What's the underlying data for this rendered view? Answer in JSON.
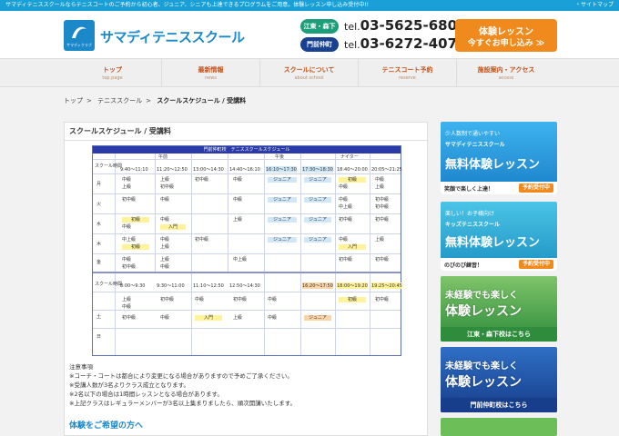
{
  "topbar": {
    "message": "サマディテニススクールならテニスコートのご予約から初心者、ジュニア、シニアも上達できるプログラムをご用意。体験レッスン申し込み受付中!!",
    "sitemap": "・サイトマップ"
  },
  "header": {
    "logo_small": "サマディクラブ",
    "logo_text": "サマディテニススクール",
    "areas": [
      "江東・森下",
      "門前仲町"
    ],
    "tel_prefix": "tel.",
    "tels": [
      "03-5625-6801",
      "03-6272-4077"
    ],
    "cta_line1": "体験レッスン",
    "cta_line2": "今すぐお申し込み ≫"
  },
  "nav": [
    {
      "jp": "トップ",
      "en": "top page"
    },
    {
      "jp": "最新情報",
      "en": "news"
    },
    {
      "jp": "スクールについて",
      "en": "about school"
    },
    {
      "jp": "テニスコート予約",
      "en": "reserve"
    },
    {
      "jp": "施設案内・アクセス",
      "en": "access"
    }
  ],
  "breadcrumb": [
    "トップ",
    "テニススクール",
    "スクールスケジュール / 受講料"
  ],
  "page_title": "スクールスケジュール / 受講料",
  "schedule": {
    "title": "門前仲町校　テニススクールスケジュール",
    "times_top": [
      "9:40〜11:10",
      "11:20〜12:50",
      "13:00〜14:30",
      "14:40〜16:10",
      "16:10〜17:30",
      "17:30〜18:30",
      "18:40〜20:00",
      "20:05〜21:25"
    ],
    "times_bottom": [
      "8:00〜9:30",
      "9:30〜11:00",
      "11:10〜12:50",
      "12:50〜14:30",
      "16:20〜17:50",
      "18:00〜19:20",
      "19:25〜20:45"
    ],
    "row_label": "スクール時間",
    "days": [
      "月",
      "火",
      "水",
      "木",
      "金",
      "土",
      "日"
    ],
    "levels": [
      "中級",
      "上級",
      "初中級",
      "初級",
      "入門",
      "中上級",
      "ジュニア"
    ],
    "sections": [
      "午前",
      "午後",
      "ナイター"
    ]
  },
  "notes": {
    "heading": "注意事項",
    "lines": [
      "※コーチ・コートは都合により変更になる場合がありますので予めご了承ください。",
      "※受講人数が3名よりクラス成立となります。",
      "※2名以下の場合は1時間レッスンとなる場合があります。",
      "※上記クラスはレギュラーメンバーが3名以上集まりましたら、順次開講いたします。"
    ]
  },
  "experience_heading": "体験をご希望の方へ",
  "sidebar": {
    "ban1": {
      "small": "少人数制で通いやすい",
      "name": "サマディテニススクール",
      "big": "無料体験レッスン",
      "bar_text": "笑顔で楽しく上達！",
      "bar_btn": "予約受付中"
    },
    "ban2": {
      "small": "楽しい！お子様向け",
      "name": "キッズテニススクール",
      "big": "無料体験レッスン",
      "bar_text": "のびのび練習！",
      "bar_btn": "予約受付中"
    },
    "ban3": {
      "line1": "未経験でも楽しく",
      "line2": "体験レッスン",
      "foot": "江東・森下校はこちら"
    },
    "ban4": {
      "line1": "未経験でも楽しく",
      "line2": "体験レッスン",
      "foot": "門前仲町校はこちら"
    }
  },
  "colors": {
    "accent": "#1aa0d6",
    "brand": "#1a88c9",
    "cta": "#f08a1d",
    "nav_text": "#c2541c"
  }
}
